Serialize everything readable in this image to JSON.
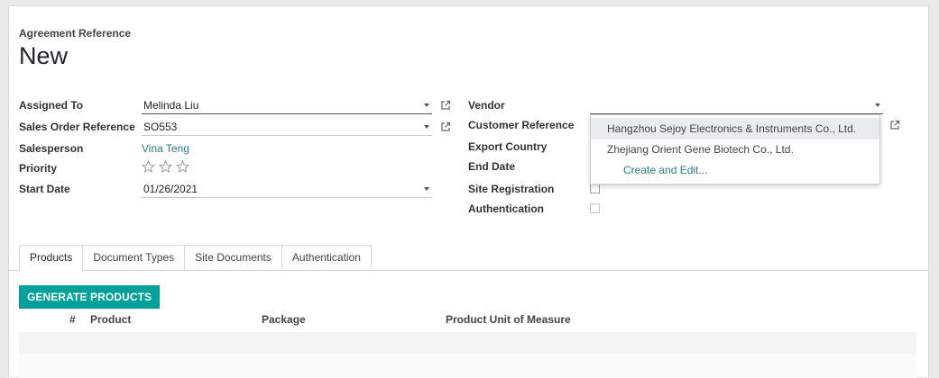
{
  "header": {
    "ref_label": "Agreement Reference",
    "title": "New"
  },
  "left": {
    "assigned_to": {
      "label": "Assigned To",
      "value": "Melinda Liu"
    },
    "sales_order": {
      "label": "Sales Order Reference",
      "value": "SO553"
    },
    "salesperson": {
      "label": "Salesperson",
      "value": "Vina Teng"
    },
    "priority": {
      "label": "Priority",
      "stars": 3,
      "value": 0
    },
    "start_date": {
      "label": "Start Date",
      "value": "01/26/2021"
    }
  },
  "right": {
    "vendor": {
      "label": "Vendor",
      "value": ""
    },
    "customer_ref": {
      "label": "Customer Reference"
    },
    "export_country": {
      "label": "Export Country"
    },
    "end_date": {
      "label": "End Date"
    },
    "site_registration": {
      "label": "Site Registration",
      "checked": false
    },
    "authentication": {
      "label": "Authentication",
      "checked": false
    }
  },
  "dropdown": {
    "options": [
      "Hangzhou Sejoy Electronics & Instruments Co., Ltd.",
      "Zhejiang Orient Gene Biotech Co., Ltd."
    ],
    "create": "Create and Edit..."
  },
  "tabs": [
    "Products",
    "Document Types",
    "Site Documents",
    "Authentication"
  ],
  "active_tab": "Products",
  "generate_button": "GENERATE PRODUCTS",
  "table": {
    "columns": [
      "#",
      "Product",
      "Package",
      "Product Unit of Measure"
    ]
  },
  "colors": {
    "accent": "#00a09d",
    "link": "#2a7f8b"
  }
}
